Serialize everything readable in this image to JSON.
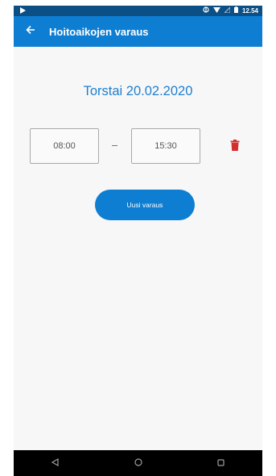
{
  "status_bar": {
    "time": "12.54"
  },
  "app_bar": {
    "title": "Hoitoaikojen varaus"
  },
  "main": {
    "date": "Torstai 20.02.2020",
    "reservation": {
      "start": "08:00",
      "end": "15:30"
    },
    "new_button_label": "Uusi varaus"
  },
  "colors": {
    "primary": "#0e7ed3",
    "status_bar": "#0b4f85",
    "date_text": "#1e7fd0",
    "delete": "#d32f2f"
  },
  "icons": {
    "back": "arrow-left-icon",
    "delete": "trash-icon",
    "nav_back": "triangle-back-icon",
    "nav_home": "circle-home-icon",
    "nav_recent": "square-recent-icon"
  }
}
